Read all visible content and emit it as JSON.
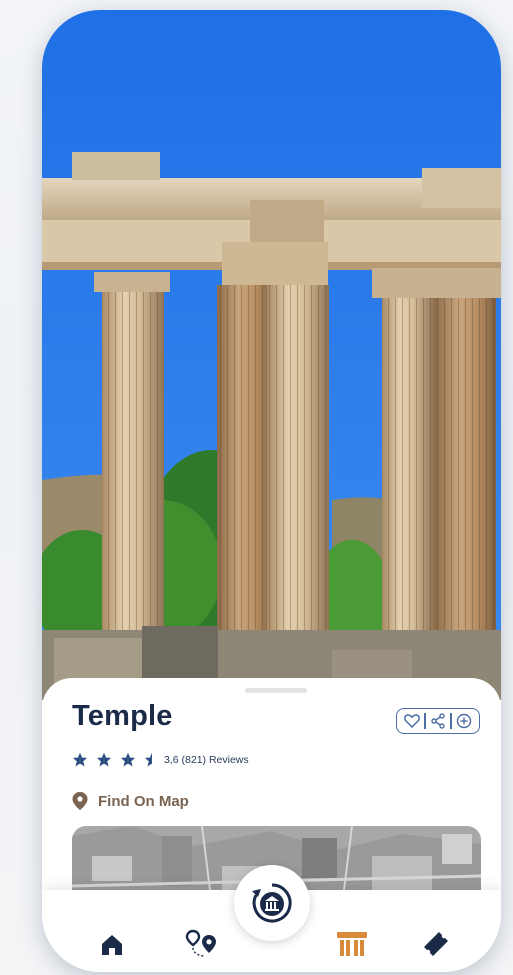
{
  "place": {
    "title": "Temple",
    "rating_value": 3.6,
    "max_rating": 5,
    "rating_text": "3,6 (821) Reviews"
  },
  "actions": {
    "favorite_icon": "heart-icon",
    "share_icon": "share-icon",
    "add_icon": "plus-circle-icon"
  },
  "map_link": {
    "label": "Find On Map",
    "icon": "location-pin-icon"
  },
  "nav": {
    "items": [
      {
        "icon": "home-icon"
      },
      {
        "icon": "route-icon"
      },
      {
        "icon": "museum-history-icon",
        "center": true
      },
      {
        "icon": "column-icon",
        "active": true
      },
      {
        "icon": "ticket-icon"
      }
    ]
  },
  "colors": {
    "primary": "#1c2a4a",
    "accent_blue": "#4d6ea8",
    "star": "#2f4f85",
    "brown": "#7a6350",
    "orange": "#d88a3a"
  }
}
